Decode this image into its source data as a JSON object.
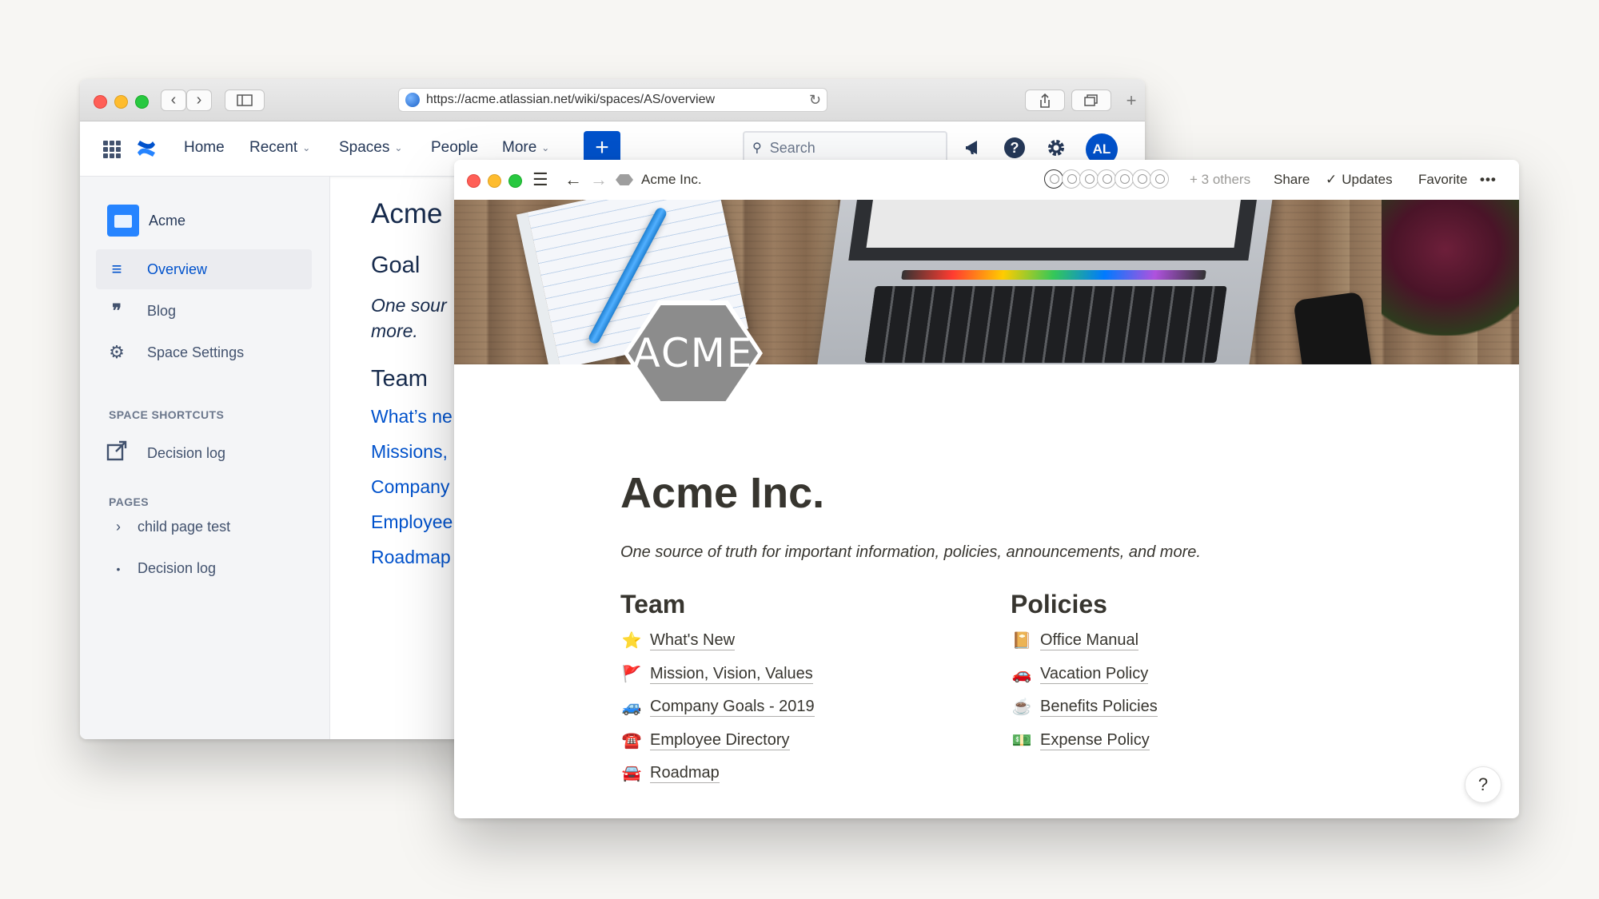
{
  "safari": {
    "url": "https://acme.atlassian.net/wiki/spaces/AS/overview"
  },
  "confluence": {
    "nav": {
      "home": "Home",
      "recent": "Recent",
      "spaces": "Spaces",
      "people": "People",
      "more": "More",
      "create": "+",
      "search_placeholder": "Search",
      "avatar_initials": "AL"
    },
    "sidebar": {
      "space_name": "Acme",
      "items": [
        {
          "label": "Overview",
          "icon": "lines-icon"
        },
        {
          "label": "Blog",
          "icon": "quote-icon"
        },
        {
          "label": "Space Settings",
          "icon": "gear-icon"
        }
      ],
      "shortcuts_heading": "SPACE SHORTCUTS",
      "shortcuts": [
        {
          "label": "Decision log",
          "icon": "external-link-icon"
        }
      ],
      "pages_heading": "PAGES",
      "pages": [
        {
          "label": "child page test",
          "marker": "›"
        },
        {
          "label": "Decision log",
          "marker": "•"
        }
      ]
    },
    "main": {
      "title": "Acme",
      "goal_heading": "Goal",
      "goal_text_line1": "One sour",
      "goal_text_line2": "more.",
      "team_heading": "Team",
      "links": [
        "What’s ne",
        "Missions,",
        "Company",
        "Employee",
        "Roadmap"
      ]
    }
  },
  "notion": {
    "breadcrumb": "Acme Inc.",
    "others": "+ 3 others",
    "share": "Share",
    "updates": "Updates",
    "favorite": "Favorite",
    "more": "•••",
    "logo_text": "ACME",
    "title": "Acme Inc.",
    "subtitle": "One source of truth for important information, policies, announcements, and more.",
    "team": {
      "heading": "Team",
      "links": [
        {
          "emoji": "⭐",
          "label": "What's New"
        },
        {
          "emoji": "🚩",
          "label": "Mission, Vision, Values"
        },
        {
          "emoji": "🚙",
          "label": "Company Goals - 2019"
        },
        {
          "emoji": "☎️",
          "label": "Employee Directory"
        },
        {
          "emoji": "🚘",
          "label": "Roadmap"
        }
      ]
    },
    "policies": {
      "heading": "Policies",
      "links": [
        {
          "emoji": "📔",
          "label": "Office Manual"
        },
        {
          "emoji": "🚗",
          "label": "Vacation Policy"
        },
        {
          "emoji": "☕",
          "label": "Benefits Policies"
        },
        {
          "emoji": "💵",
          "label": "Expense Policy"
        }
      ]
    },
    "help": "?"
  },
  "colors": {
    "confluence_blue": "#0052cc",
    "notion_text": "#37352f",
    "background": "#f7f6f3"
  }
}
